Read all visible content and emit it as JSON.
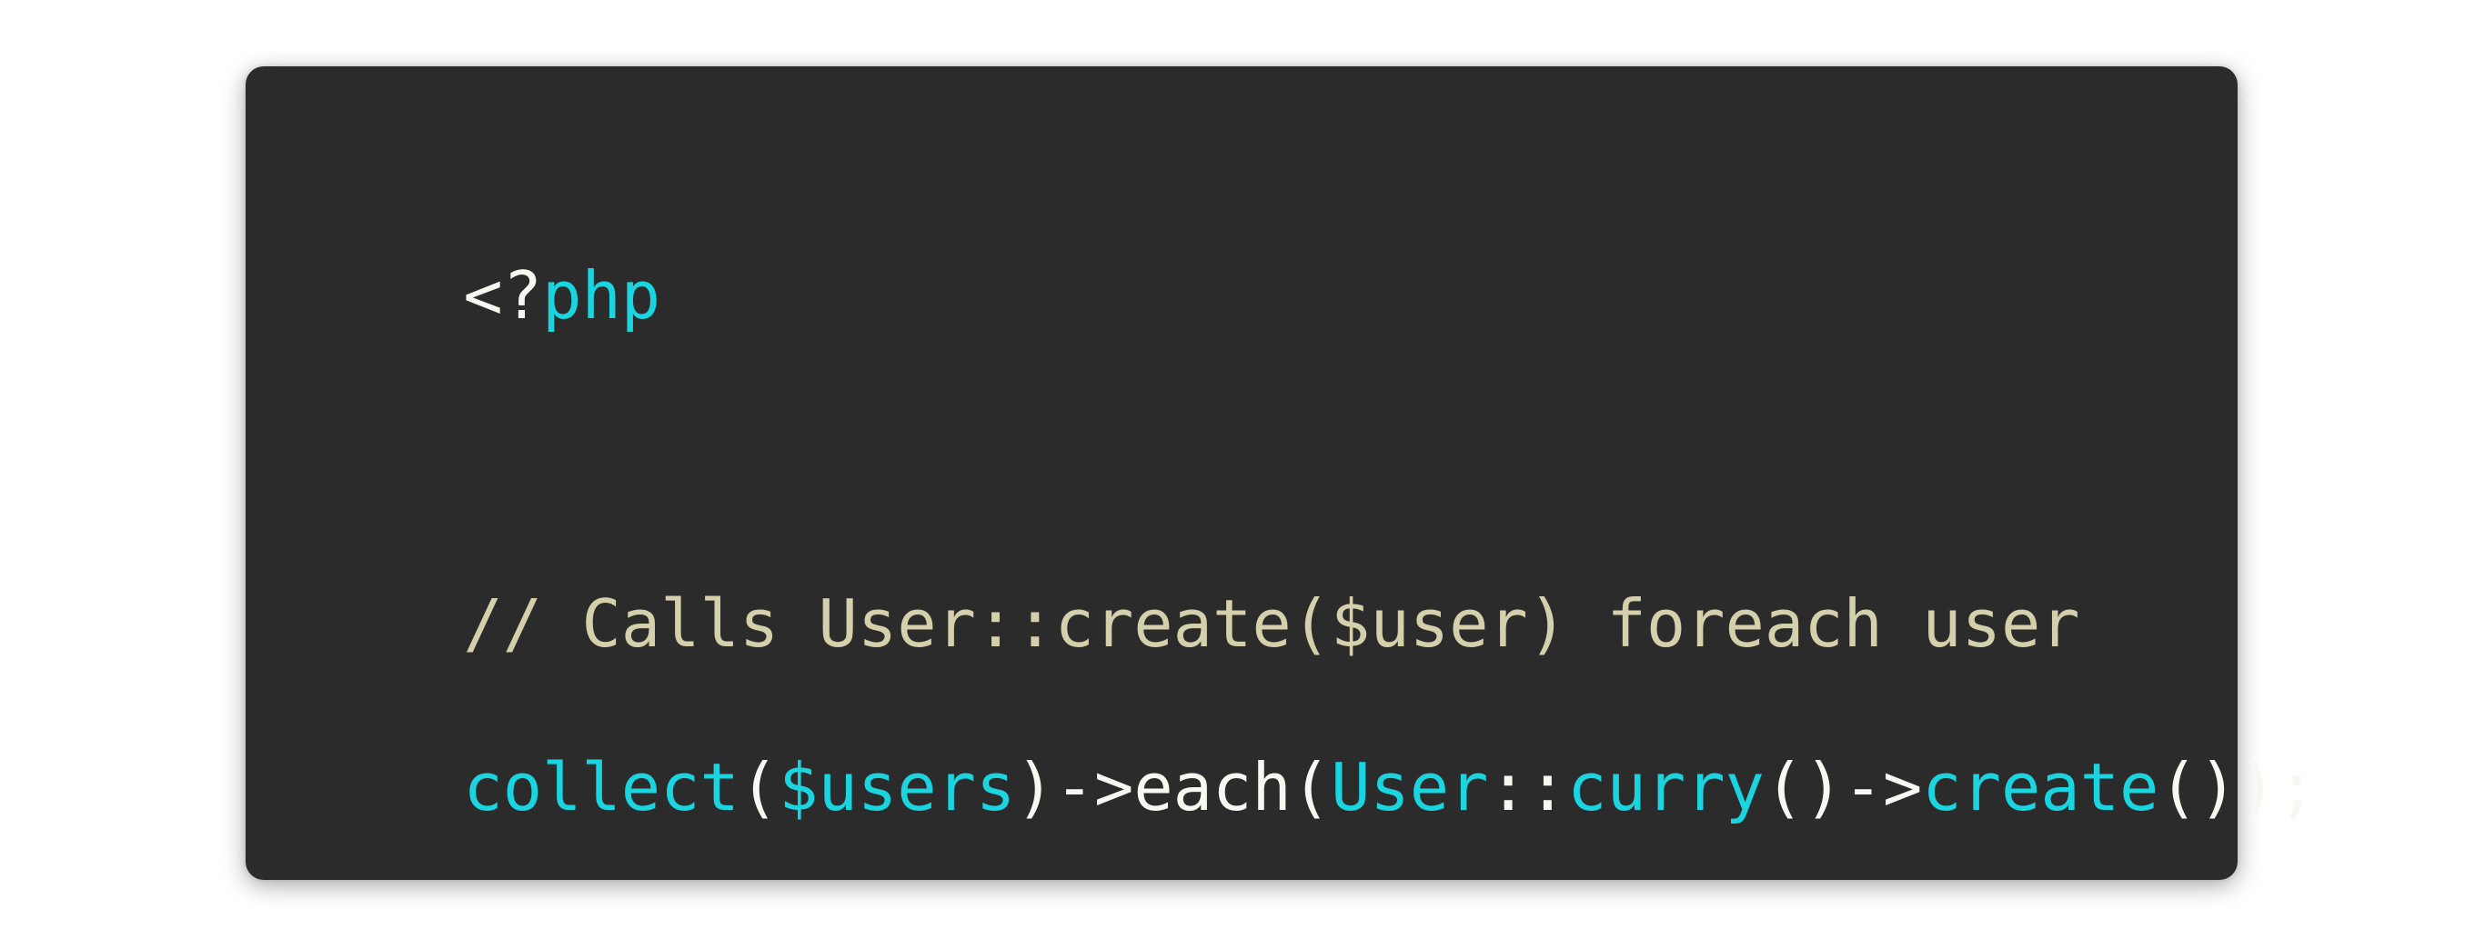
{
  "colors": {
    "background": "#ffffff",
    "editor_background": "#2b2b2b",
    "plain_text": "#f8f8f2",
    "keyword": "#1ad4e0",
    "comment": "#d4d0ab"
  },
  "code": {
    "lines": [
      {
        "tokens": [
          {
            "text": "<?",
            "kind": "plain"
          },
          {
            "text": "php",
            "kind": "keyword"
          }
        ]
      },
      {
        "tokens": [
          {
            "text": "// Calls User::create($user) foreach user",
            "kind": "comment"
          }
        ]
      },
      {
        "tokens": [
          {
            "text": "collect",
            "kind": "keyword"
          },
          {
            "text": "(",
            "kind": "plain"
          },
          {
            "text": "$users",
            "kind": "keyword"
          },
          {
            "text": ")->each(",
            "kind": "plain"
          },
          {
            "text": "User",
            "kind": "keyword"
          },
          {
            "text": "::",
            "kind": "plain"
          },
          {
            "text": "curry",
            "kind": "keyword"
          },
          {
            "text": "()->",
            "kind": "plain"
          },
          {
            "text": "create",
            "kind": "keyword"
          },
          {
            "text": "());",
            "kind": "plain"
          }
        ]
      }
    ]
  }
}
